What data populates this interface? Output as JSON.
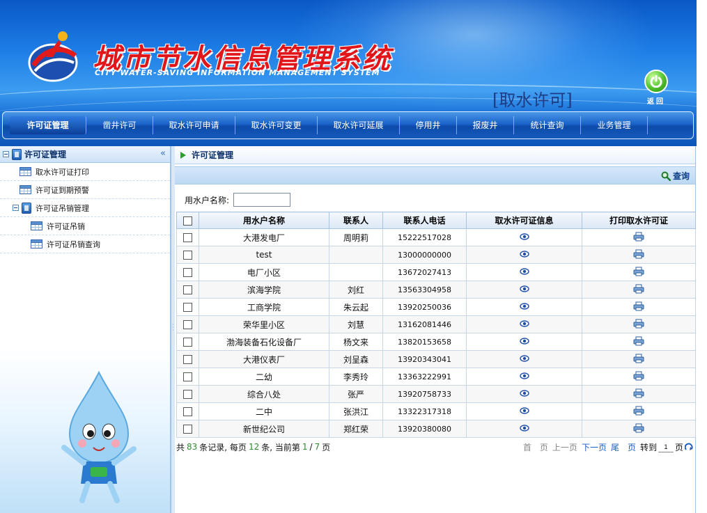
{
  "header": {
    "title": "城市节水信息管理系统",
    "subtitle": "CITY WATER-SAVING INFORMATION MANAGEMENT SYSTEM",
    "module": "[取水许可]",
    "back_label": "返回"
  },
  "nav": {
    "items": [
      {
        "label": "许可证管理",
        "active": true
      },
      {
        "label": "凿井许可"
      },
      {
        "label": "取水许可申请"
      },
      {
        "label": "取水许可变更"
      },
      {
        "label": "取水许可延展"
      },
      {
        "label": "停用井"
      },
      {
        "label": "报废井"
      },
      {
        "label": "统计查询"
      },
      {
        "label": "业务管理"
      }
    ]
  },
  "sidebar": {
    "title": "许可证管理",
    "collapse": "«",
    "items": [
      {
        "label": "取水许可证打印"
      },
      {
        "label": "许可证到期预警"
      },
      {
        "label": "许可证吊销管理"
      },
      {
        "label": "许可证吊销"
      },
      {
        "label": "许可证吊销查询"
      }
    ]
  },
  "main": {
    "title": "许可证管理",
    "search_label": "查询",
    "filter_label": "用水户名称:",
    "filter_value": "",
    "columns": [
      "用水户名称",
      "联系人",
      "联系人电话",
      "取水许可证信息",
      "打印取水许可证"
    ],
    "rows": [
      {
        "name": "大港发电厂",
        "contact": "周明莉",
        "phone": "15222517028"
      },
      {
        "name": "test",
        "contact": "",
        "phone": "13000000000"
      },
      {
        "name": "电厂小区",
        "contact": "",
        "phone": "13672027413"
      },
      {
        "name": "滨海学院",
        "contact": "刘红",
        "phone": "13563304958"
      },
      {
        "name": "工商学院",
        "contact": "朱云起",
        "phone": "13920250036"
      },
      {
        "name": "荣华里小区",
        "contact": "刘慧",
        "phone": "13162081446"
      },
      {
        "name": "渤海装备石化设备厂",
        "contact": "杨文来",
        "phone": "13820153658"
      },
      {
        "name": "大港仪表厂",
        "contact": "刘呈森",
        "phone": "13920343041"
      },
      {
        "name": "二幼",
        "contact": "李秀玲",
        "phone": "13363222991"
      },
      {
        "name": "综合八处",
        "contact": "张严",
        "phone": "13920758733"
      },
      {
        "name": "二中",
        "contact": "张洪江",
        "phone": "13322317318"
      },
      {
        "name": "新世纪公司",
        "contact": "郑红荣",
        "phone": "13920380080"
      }
    ]
  },
  "pager": {
    "prefix": "共",
    "total": "83",
    "records_per": "条记录, 每页",
    "per_page": "12",
    "current_text": "条, 当前第",
    "current": "1",
    "slash": "/",
    "pages": "7",
    "page_suffix": "页",
    "first": "首　页",
    "prev": "上一页",
    "next": "下一页",
    "last": "尾　页",
    "goto_label": "转到",
    "goto_value": "1",
    "goto_suffix": "页"
  },
  "colors": {
    "title_red": "#e0161b",
    "nav_blue": "#0c4aa9",
    "pager_green": "#2e8b2e",
    "link_blue": "#1b5fc0"
  }
}
